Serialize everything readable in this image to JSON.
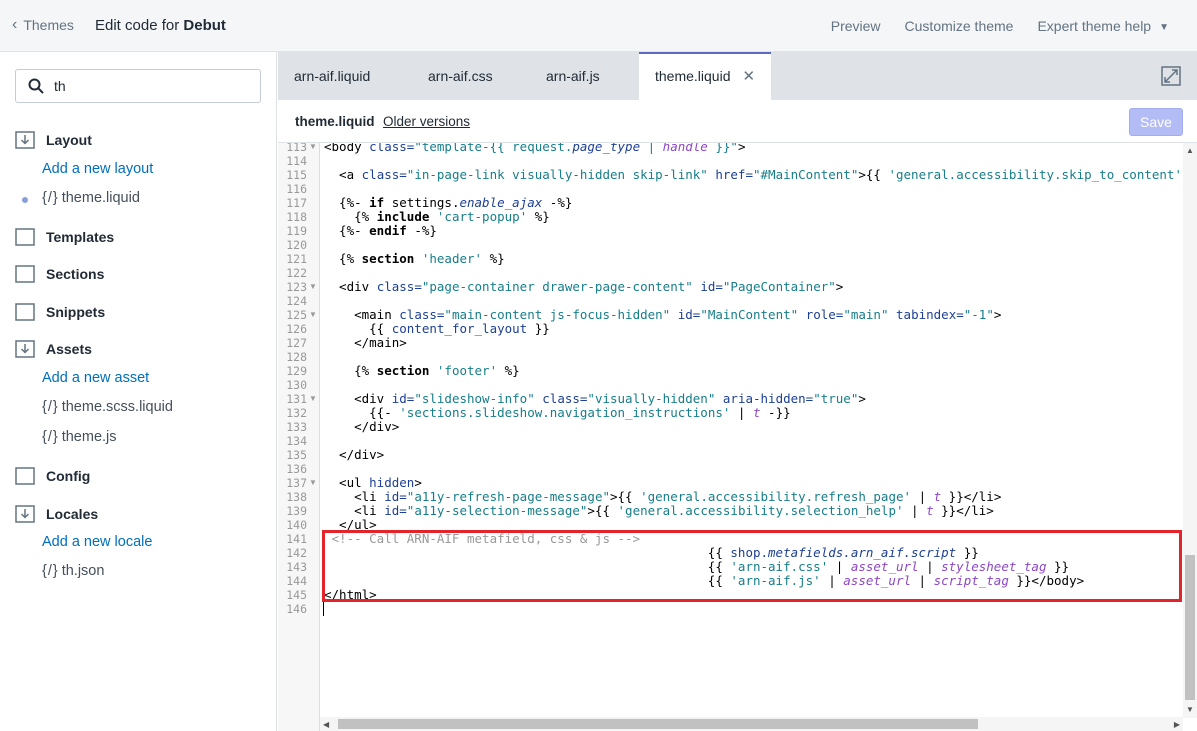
{
  "topbar": {
    "back_label": "Themes",
    "title_prefix": "Edit code for ",
    "title_theme": "Debut",
    "links": [
      "Preview",
      "Customize theme",
      "Expert theme help"
    ]
  },
  "sidebar": {
    "search_value": "th",
    "folders": {
      "layout": "Layout",
      "templates": "Templates",
      "sections": "Sections",
      "snippets": "Snippets",
      "assets": "Assets",
      "config": "Config",
      "locales": "Locales"
    },
    "add_layout": "Add a new layout",
    "add_asset": "Add a new asset",
    "add_locale": "Add a new locale",
    "files": {
      "theme_liquid": "theme.liquid",
      "theme_scss": "theme.scss.liquid",
      "theme_js": "theme.js",
      "th_json": "th.json"
    }
  },
  "tabs": [
    "arn-aif.liquid",
    "arn-aif.css",
    "arn-aif.js",
    "theme.liquid"
  ],
  "active_tab": "theme.liquid",
  "file_header": {
    "name": "theme.liquid",
    "older_versions": "Older versions",
    "save_label": "Save"
  },
  "editor": {
    "line_numbers": [
      "113",
      "114",
      "115",
      "116",
      "117",
      "118",
      "119",
      "120",
      "121",
      "122",
      "123",
      "124",
      "125",
      "126",
      "127",
      "128",
      "129",
      "130",
      "131",
      "132",
      "133",
      "134",
      "135",
      "136",
      "137",
      "138",
      "139",
      "140",
      "141",
      "142",
      "143",
      "144",
      "145",
      "146"
    ]
  }
}
